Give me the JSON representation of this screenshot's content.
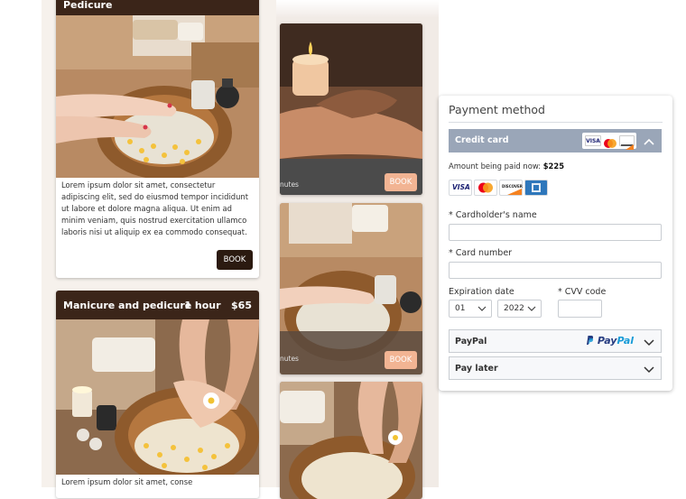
{
  "cards": {
    "pedicure": {
      "title": "Pedicure",
      "description": "Lorem ipsum dolor sit amet, consectetur adipiscing elit, sed do eiusmod tempor incididunt ut labore et dolore magna aliqua. Ut enim ad minim veniam, quis nostrud exercitation ullamco laboris nisi ut aliquip ex ea commodo consequat.",
      "book_label": "BOOK"
    },
    "mani_pedi": {
      "title": "Manicure and pedicure",
      "duration": "1 hour",
      "price": "$65",
      "description": "Lorem ipsum dolor sit amet, conse"
    },
    "right_col": {
      "book_label_1": "BOOK",
      "book_label_2": "BOOK",
      "minutes_1": "nutes",
      "minutes_2": "nutes"
    }
  },
  "payment": {
    "title": "Payment method",
    "credit_card": {
      "label": "Credit card",
      "amount_prefix": "Amount being paid now:",
      "amount_value": "$225",
      "brands": [
        "visa-icon",
        "mastercard-icon",
        "discover-icon",
        "amex-icon"
      ],
      "visa_text": "VISA",
      "discover_text": "DISCOVER",
      "cardholder_label": "Cardholder's name",
      "card_number_label": "Card number",
      "expiration_label": "Expiration date",
      "cvv_label": "CVV code",
      "month": "01",
      "year": "2022",
      "required_mark": "*"
    },
    "paypal": {
      "label": "PayPal",
      "logo_text_pay": "Pay",
      "logo_text_pal": "Pal"
    },
    "pay_later": {
      "label": "Pay later"
    }
  },
  "colors": {
    "header_dark": "#3b2519",
    "accordion_active": "#9aa6b8",
    "paypal_dark": "#253b80",
    "paypal_light": "#179bd7",
    "book_peach": "#f2b493"
  }
}
